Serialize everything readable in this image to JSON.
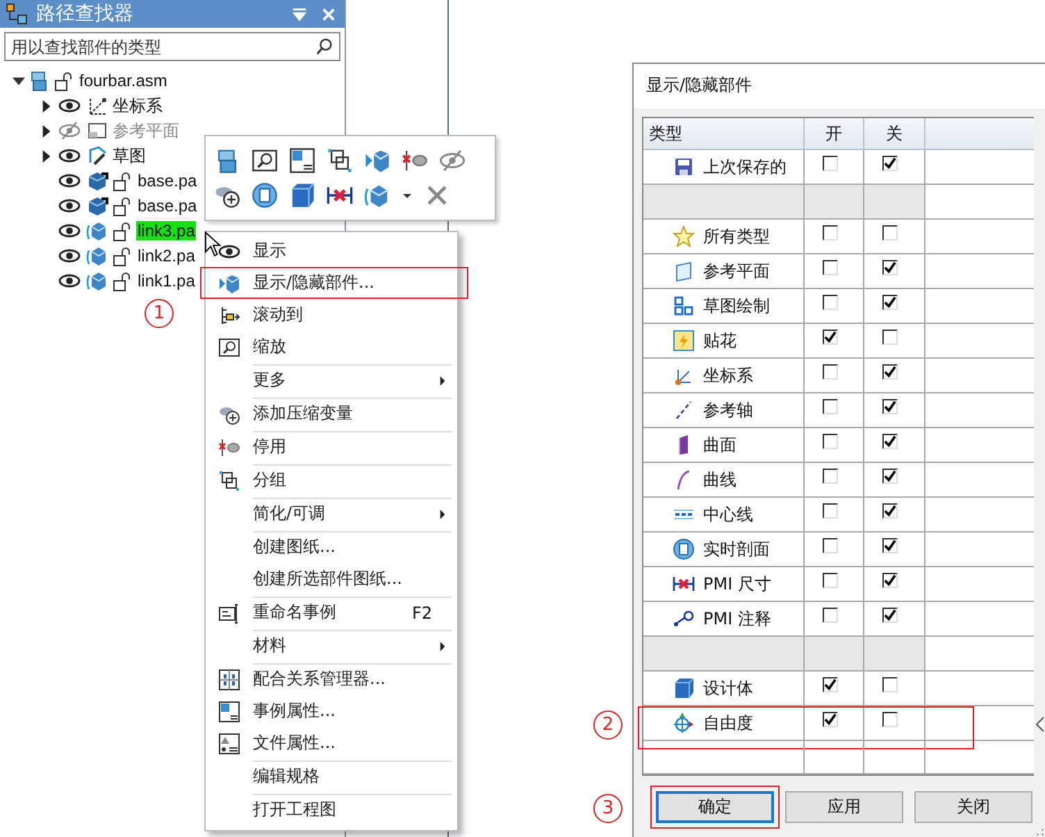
{
  "finder": {
    "title": "路径查找器",
    "search": {
      "placeholder": "用以查找部件的类型"
    },
    "tree": {
      "label": "fourbar.asm",
      "kind": "assembly",
      "expanded": true,
      "children": [
        {
          "label": "坐标系",
          "kind": "coord",
          "visible": true,
          "expanded": false,
          "selected": false
        },
        {
          "label": "参考平面",
          "kind": "plane",
          "visible": false,
          "expanded": false,
          "selected": false
        },
        {
          "label": "草图",
          "kind": "sketch",
          "visible": true,
          "expanded": false,
          "selected": false
        },
        {
          "label": "base.pa",
          "kind": "part",
          "visible": true,
          "selected": false
        },
        {
          "label": "base.pa",
          "kind": "part",
          "visible": true,
          "selected": false
        },
        {
          "label": "link3.pa",
          "kind": "moving_part",
          "visible": true,
          "selected": true
        },
        {
          "label": "link2.pa",
          "kind": "moving_part",
          "visible": true,
          "selected": false
        },
        {
          "label": "link1.pa",
          "kind": "moving_part",
          "visible": true,
          "selected": false
        }
      ]
    }
  },
  "context_menu": {
    "items": [
      {
        "label": "显示",
        "divider": false,
        "submenu": false,
        "annotated": false
      },
      {
        "label": "显示/隐藏部件...",
        "divider": false,
        "submenu": false,
        "annotated": true
      },
      {
        "label": "滚动到",
        "divider": false,
        "submenu": false,
        "annotated": false
      },
      {
        "label": "缩放",
        "divider": false,
        "submenu": false,
        "annotated": false
      },
      {
        "label": "更多",
        "divider": true,
        "submenu": true,
        "annotated": false
      },
      {
        "label": "添加压缩变量",
        "divider": true,
        "submenu": false,
        "annotated": false
      },
      {
        "label": "停用",
        "divider": true,
        "submenu": false,
        "annotated": false
      },
      {
        "label": "分组",
        "divider": true,
        "submenu": false,
        "annotated": false
      },
      {
        "label": "简化/可调",
        "divider": true,
        "submenu": true,
        "annotated": false
      },
      {
        "label": "创建图纸...",
        "divider": true,
        "submenu": false,
        "annotated": false
      },
      {
        "label": "创建所选部件图纸...",
        "divider": false,
        "submenu": false,
        "annotated": false
      },
      {
        "label": "重命名事例",
        "shortcut": "F2",
        "divider": true,
        "submenu": false,
        "annotated": false
      },
      {
        "label": "材料",
        "divider": true,
        "submenu": true,
        "annotated": false
      },
      {
        "label": "配合关系管理器...",
        "divider": true,
        "submenu": false,
        "annotated": false
      },
      {
        "label": "事例属性...",
        "divider": false,
        "submenu": false,
        "annotated": false
      },
      {
        "label": "文件属性...",
        "divider": false,
        "submenu": false,
        "annotated": false
      },
      {
        "label": "编辑规格",
        "divider": true,
        "submenu": false,
        "annotated": false
      },
      {
        "label": "打开工程图",
        "divider": true,
        "submenu": false,
        "annotated": false
      }
    ]
  },
  "dialog": {
    "title": "显示/隐藏部件",
    "columns": [
      "类型",
      "开",
      "关"
    ],
    "rows": [
      {
        "kind": "item",
        "label": "上次保存的",
        "on": false,
        "off": true,
        "annotated": false
      },
      {
        "kind": "blank"
      },
      {
        "kind": "item",
        "label": "所有类型",
        "on": false,
        "off": false,
        "annotated": false
      },
      {
        "kind": "item",
        "label": "参考平面",
        "on": false,
        "off": true,
        "annotated": false
      },
      {
        "kind": "item",
        "label": "草图绘制",
        "on": false,
        "off": true,
        "annotated": false
      },
      {
        "kind": "item",
        "label": "贴花",
        "on": true,
        "off": false,
        "annotated": false
      },
      {
        "kind": "item",
        "label": "坐标系",
        "on": false,
        "off": true,
        "annotated": false
      },
      {
        "kind": "item",
        "label": "参考轴",
        "on": false,
        "off": true,
        "annotated": false
      },
      {
        "kind": "item",
        "label": "曲面",
        "on": false,
        "off": true,
        "annotated": false
      },
      {
        "kind": "item",
        "label": "曲线",
        "on": false,
        "off": true,
        "annotated": false
      },
      {
        "kind": "item",
        "label": "中心线",
        "on": false,
        "off": true,
        "annotated": false
      },
      {
        "kind": "item",
        "label": "实时剖面",
        "on": false,
        "off": true,
        "annotated": false
      },
      {
        "kind": "item",
        "label": "PMI 尺寸",
        "on": false,
        "off": true,
        "annotated": false
      },
      {
        "kind": "item",
        "label": "PMI 注释",
        "on": false,
        "off": true,
        "annotated": false
      },
      {
        "kind": "blank"
      },
      {
        "kind": "item",
        "label": "设计体",
        "on": true,
        "off": false,
        "annotated": false
      },
      {
        "kind": "item",
        "label": "自由度",
        "on": true,
        "off": false,
        "annotated": true
      },
      {
        "kind": "empty"
      }
    ],
    "buttons": [
      {
        "label": "确定",
        "default": true,
        "annotated": true
      },
      {
        "label": "应用",
        "default": false,
        "annotated": false
      },
      {
        "label": "关闭",
        "default": false,
        "annotated": false
      }
    ]
  },
  "callouts": [
    "1",
    "2",
    "3"
  ]
}
